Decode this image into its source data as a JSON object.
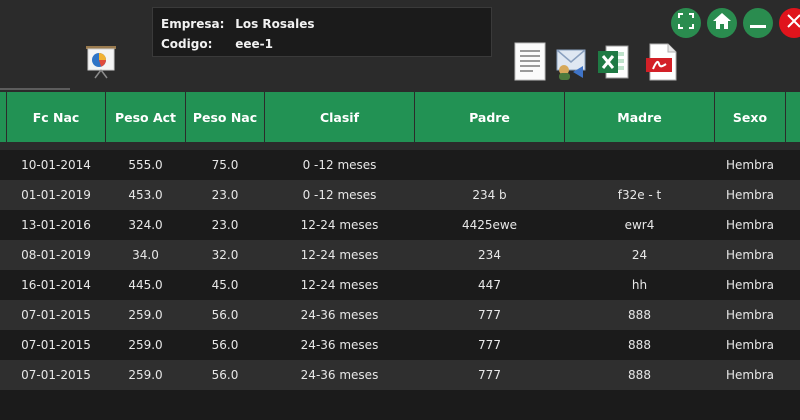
{
  "info": {
    "company_label": "Empresa:",
    "company_value": "Los Rosales",
    "code_label": "Codigo:",
    "code_value": "eee-1"
  },
  "icons": {
    "report": "report-chart-icon",
    "text_doc": "text-document-icon",
    "mail": "mail-export-icon",
    "excel": "excel-export-icon",
    "pdf": "pdf-export-icon",
    "fullscreen": "fullscreen-icon",
    "home": "home-icon",
    "minimize": "minimize-icon",
    "close": "close-icon"
  },
  "colors": {
    "header_green": "#229254",
    "button_green": "#2a8c4f",
    "close_red": "#e0141c",
    "row_dark": "#1b1b1b",
    "row_light": "#2f2f2f"
  },
  "table": {
    "columns": [
      "Fc Nac",
      "Peso Act",
      "Peso Nac",
      "Clasif",
      "Padre",
      "Madre",
      "Sexo"
    ],
    "rows": [
      [
        "10-01-2014",
        "555.0",
        "75.0",
        "0 -12 meses",
        "",
        "",
        "Hembra"
      ],
      [
        "01-01-2019",
        "453.0",
        "23.0",
        "0 -12 meses",
        "234 b",
        "f32e - t",
        "Hembra"
      ],
      [
        "13-01-2016",
        "324.0",
        "23.0",
        "12-24 meses",
        "4425ewe",
        "ewr4",
        "Hembra"
      ],
      [
        "08-01-2019",
        "34.0",
        "32.0",
        "12-24 meses",
        "234",
        "24",
        "Hembra"
      ],
      [
        "16-01-2014",
        "445.0",
        "45.0",
        "12-24 meses",
        "447",
        "hh",
        "Hembra"
      ],
      [
        "07-01-2015",
        "259.0",
        "56.0",
        "24-36 meses",
        "777",
        "888",
        "Hembra"
      ],
      [
        "07-01-2015",
        "259.0",
        "56.0",
        "24-36 meses",
        "777",
        "888",
        "Hembra"
      ],
      [
        "07-01-2015",
        "259.0",
        "56.0",
        "24-36 meses",
        "777",
        "888",
        "Hembra"
      ]
    ]
  }
}
